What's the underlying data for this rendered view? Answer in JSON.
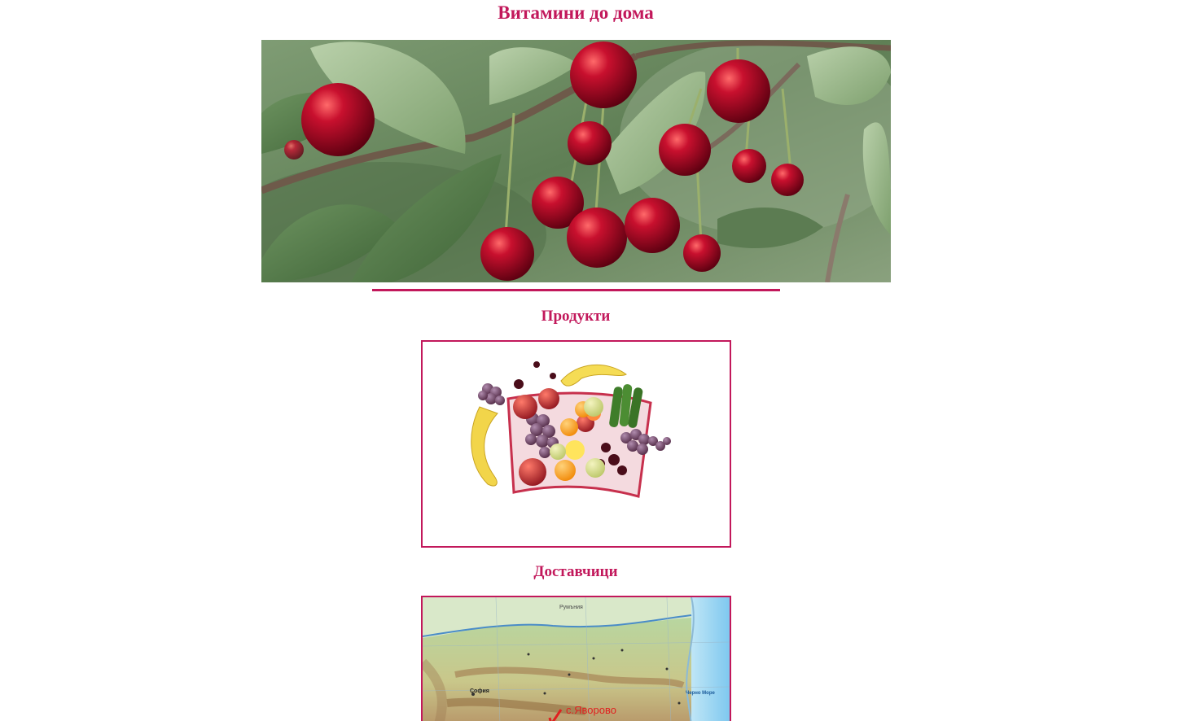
{
  "header": {
    "title": "Витамини до дома"
  },
  "sections": {
    "products_title": "Продукти",
    "suppliers_title": "Доставчици"
  },
  "map": {
    "labels": {
      "romania": "Румъния",
      "sofia": "София",
      "black_sea": "Черно Море",
      "village": "с.Яворово"
    }
  },
  "colors": {
    "accent": "#c2185b"
  }
}
